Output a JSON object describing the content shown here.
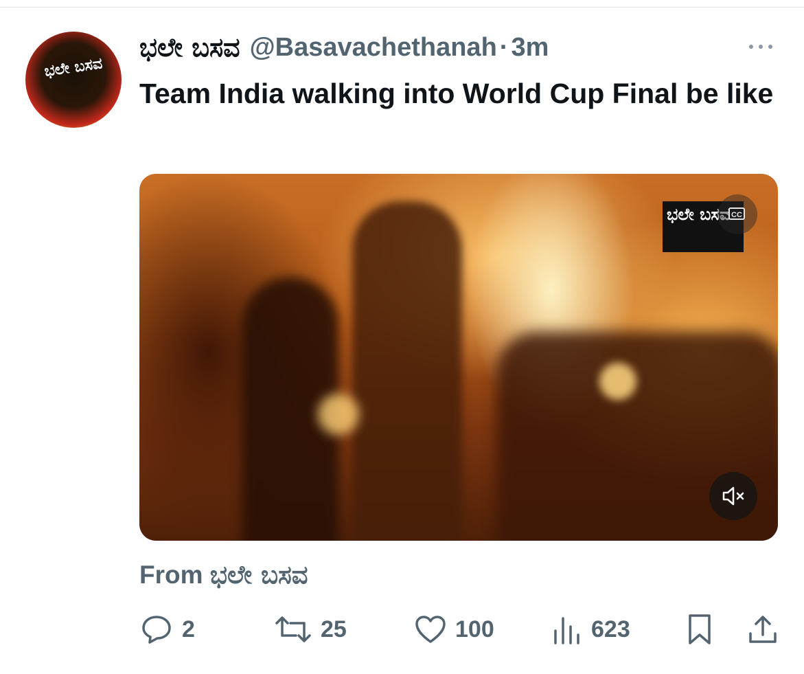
{
  "tweet": {
    "avatar_icon": "bhale-basava-logo",
    "avatar_text": "ಭಲೇ ಬಸವ",
    "display_name": "ಭಲೇ ಬಸವ",
    "handle": "@Basavachethanah",
    "separator": "·",
    "time": "3m",
    "text": "Team India walking into World Cup Final be like",
    "media": {
      "watermark_text": "ಭಲೇ ಬಸವ",
      "cc_label": "CC",
      "mute_icon": "speaker-muted-icon"
    },
    "from_prefix": "From",
    "from_name": "ಭಲೇ ಬಸವ"
  },
  "actions": {
    "replies": "2",
    "reposts": "25",
    "likes": "100",
    "views": "623"
  },
  "colors": {
    "text_primary": "#0f1419",
    "text_secondary": "#536471",
    "avatar_ring": "#e8d21c"
  }
}
